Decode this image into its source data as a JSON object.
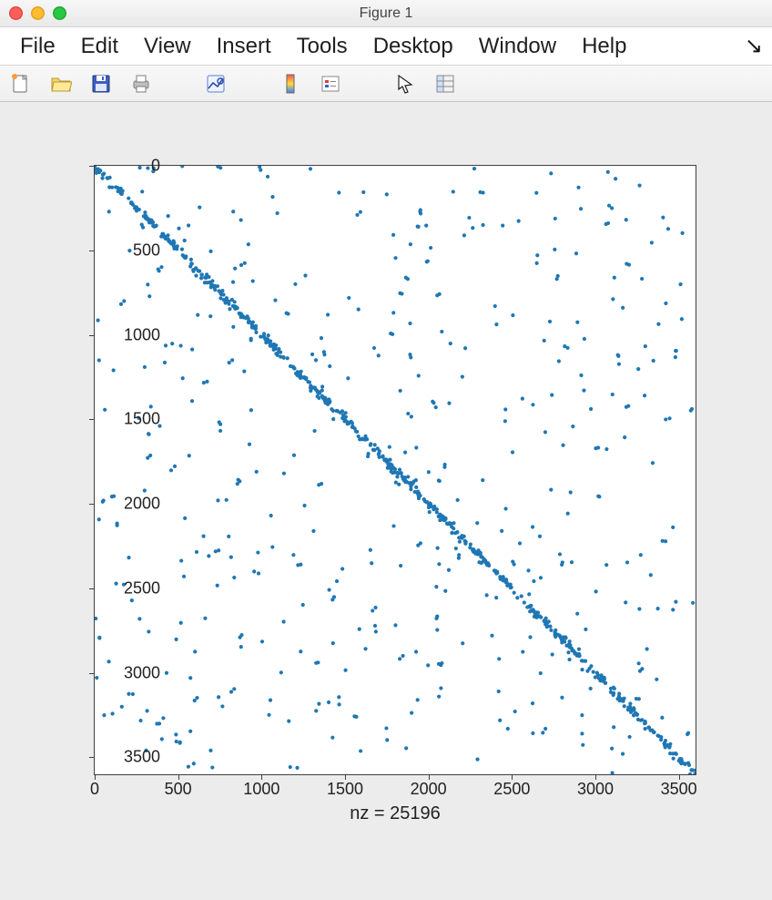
{
  "window": {
    "title": "Figure 1"
  },
  "menubar": {
    "items": [
      "File",
      "Edit",
      "View",
      "Insert",
      "Tools",
      "Desktop",
      "Window",
      "Help"
    ],
    "overflow": "↘"
  },
  "toolbar": {
    "icons": [
      "new-file-icon",
      "open-folder-icon",
      "save-icon",
      "print-icon",
      "gap",
      "data-cursor-icon",
      "gap",
      "colorbar-icon",
      "legend-icon",
      "gap",
      "pointer-icon",
      "property-inspector-icon"
    ]
  },
  "chart_data": {
    "type": "scatter",
    "title": "",
    "xlabel": "nz = 25196",
    "ylabel": "",
    "xlim": [
      0,
      3600
    ],
    "ylim": [
      0,
      3600
    ],
    "y_reversed": true,
    "x_ticks": [
      0,
      500,
      1000,
      1500,
      2000,
      2500,
      3000,
      3500
    ],
    "y_ticks": [
      0,
      500,
      1000,
      1500,
      2000,
      2500,
      3000,
      3500
    ],
    "point_count_rendered": 900,
    "pattern": "diagonal-heavy sparse matrix (spy plot)",
    "marker_color": "#1f77b4"
  }
}
